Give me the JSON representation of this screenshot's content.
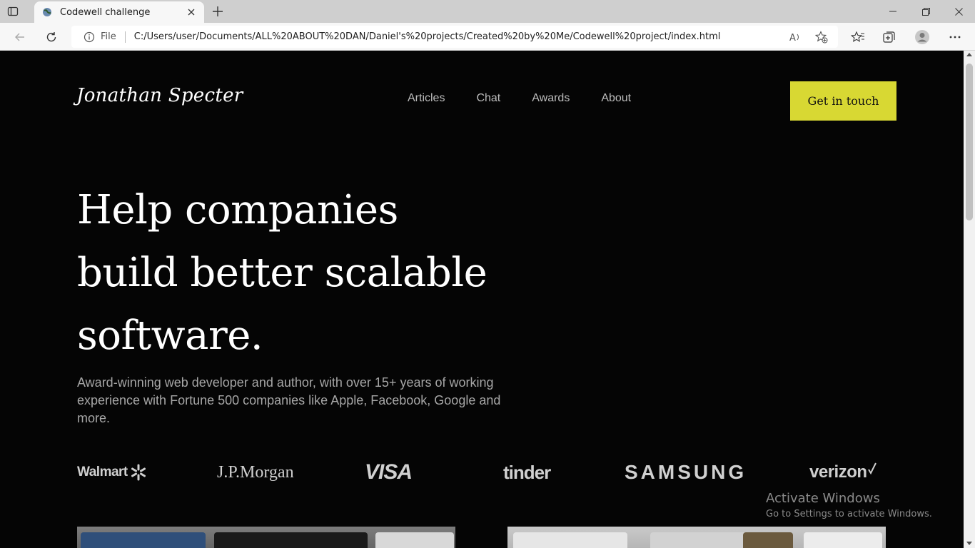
{
  "browser": {
    "tab_title": "Codewell challenge",
    "address_prefix": "File",
    "url": "C:/Users/user/Documents/ALL%20ABOUT%20DAN/Daniel's%20projects/Created%20by%20Me/Codewell%20project/index.html"
  },
  "site": {
    "brand": "Jonathan Specter",
    "nav": [
      "Articles",
      "Chat",
      "Awards",
      "About"
    ],
    "cta_label": "Get in touch",
    "hero_line1": "Help companies",
    "hero_line2": "build better scalable",
    "hero_line3": "software.",
    "hero_subtitle": "Award-winning web developer and author, with over 15+ years of working experience with Fortune 500 companies like Apple, Facebook, Google and more.",
    "logos": [
      "Walmart",
      "J.P.Morgan",
      "VISA",
      "tinder",
      "SAMSUNG",
      "verizon"
    ]
  },
  "watermark": {
    "title": "Activate Windows",
    "subtitle": "Go to Settings to activate Windows."
  },
  "colors": {
    "accent": "#d8d833",
    "background": "#050505"
  }
}
